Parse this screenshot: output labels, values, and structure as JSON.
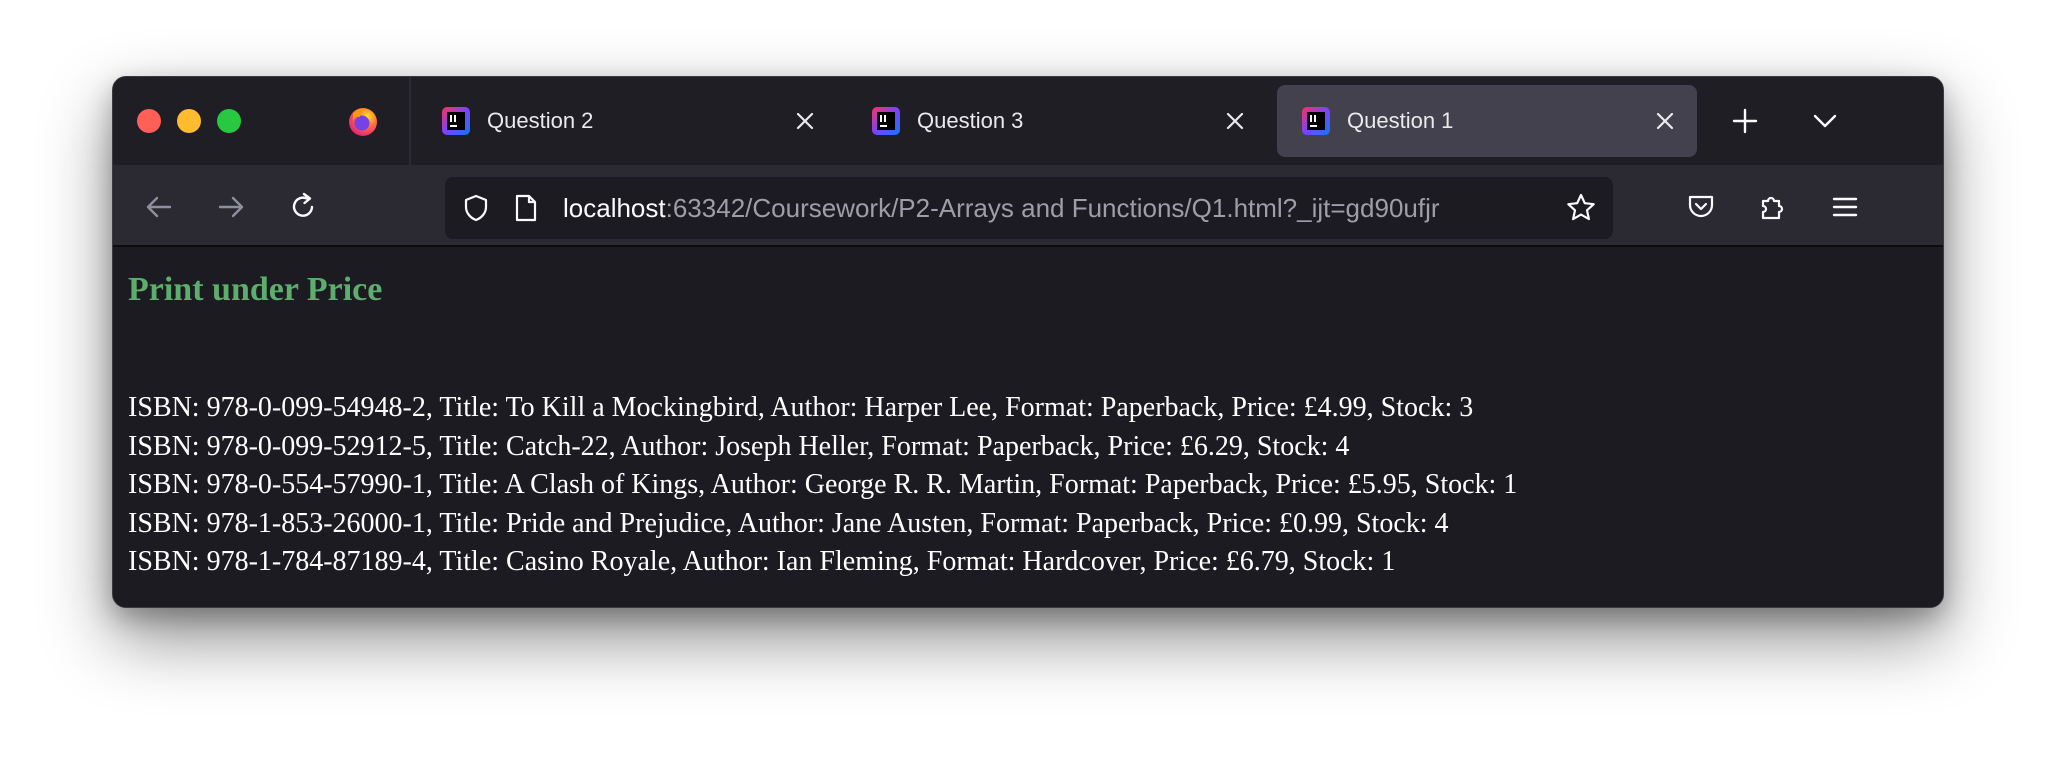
{
  "browser": {
    "tabs": [
      {
        "title": "Question 2",
        "active": false
      },
      {
        "title": "Question 3",
        "active": false
      },
      {
        "title": "Question 1",
        "active": true
      }
    ],
    "url": {
      "host": "localhost",
      "rest": ":63342/Coursework/P2-Arrays and Functions/Q1.html?_ijt=gd90ufjr"
    }
  },
  "colors": {
    "heading": "#5dad6c",
    "background": "#1c1b22",
    "active_tab": "#42414d"
  },
  "icons": {
    "app": "firefox-icon",
    "tab": "intellij-icon",
    "close": "close-icon",
    "new_tab": "plus-icon",
    "list_tabs": "chevron-down-icon",
    "back": "back-arrow-icon",
    "forward": "forward-arrow-icon",
    "reload": "reload-icon",
    "tracking": "shield-icon",
    "page": "page-icon",
    "bookmark": "star-icon",
    "pocket": "pocket-icon",
    "extensions": "puzzle-icon",
    "menu": "hamburger-menu-icon"
  },
  "page": {
    "heading": "Print under Price",
    "books": [
      "ISBN: 978-0-099-54948-2, Title: To Kill a Mockingbird, Author: Harper Lee, Format: Paperback, Price: £4.99, Stock: 3",
      "ISBN: 978-0-099-52912-5, Title: Catch-22, Author: Joseph Heller, Format: Paperback, Price: £6.29, Stock: 4",
      "ISBN: 978-0-554-57990-1, Title: A Clash of Kings, Author: George R. R. Martin, Format: Paperback, Price: £5.95, Stock: 1",
      "ISBN: 978-1-853-26000-1, Title: Pride and Prejudice, Author: Jane Austen, Format: Paperback, Price: £0.99, Stock: 4",
      "ISBN: 978-1-784-87189-4, Title: Casino Royale, Author: Ian Fleming, Format: Hardcover, Price: £6.79, Stock: 1"
    ]
  }
}
